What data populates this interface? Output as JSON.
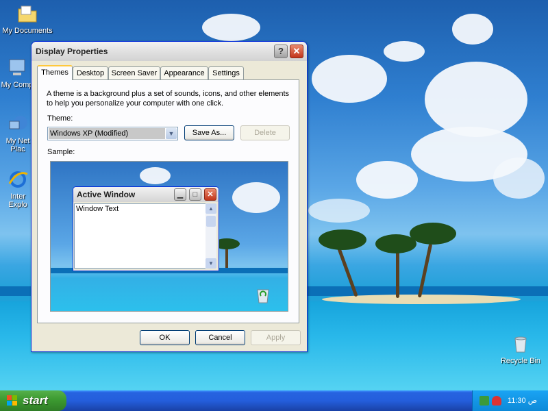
{
  "desktop": {
    "icons": [
      {
        "label": "My Documents",
        "icon": "folder-icon"
      },
      {
        "label": "My Comp",
        "icon": "computer-icon"
      },
      {
        "label": "My Net",
        "label2": "Plac",
        "icon": "network-icon"
      },
      {
        "label": "Inter",
        "label2": "Explo",
        "icon": "internet-explorer-icon"
      },
      {
        "label": "Recycle Bin",
        "icon": "recycle-bin-icon"
      }
    ]
  },
  "dialog": {
    "title": "Display Properties",
    "help_glyph": "?",
    "close_glyph": "✕",
    "tabs": [
      "Themes",
      "Desktop",
      "Screen Saver",
      "Appearance",
      "Settings"
    ],
    "active_tab": "Themes",
    "description": "A theme is a background plus a set of sounds, icons, and other elements to help you personalize your computer with one click.",
    "theme_label": "Theme:",
    "theme_value": "Windows XP (Modified)",
    "save_as_label": "Save As...",
    "delete_label": "Delete",
    "sample_label": "Sample:",
    "sample": {
      "window_title": "Active Window",
      "window_text": "Window Text"
    },
    "ok_label": "OK",
    "cancel_label": "Cancel",
    "apply_label": "Apply"
  },
  "taskbar": {
    "start_label": "start",
    "clock": "11:30 ص"
  },
  "colors": {
    "dialog_border": "#0831d9",
    "taskbar": "#245edc",
    "start_green": "#3c9a31",
    "active_tab_highlight": "#ffc83c"
  }
}
